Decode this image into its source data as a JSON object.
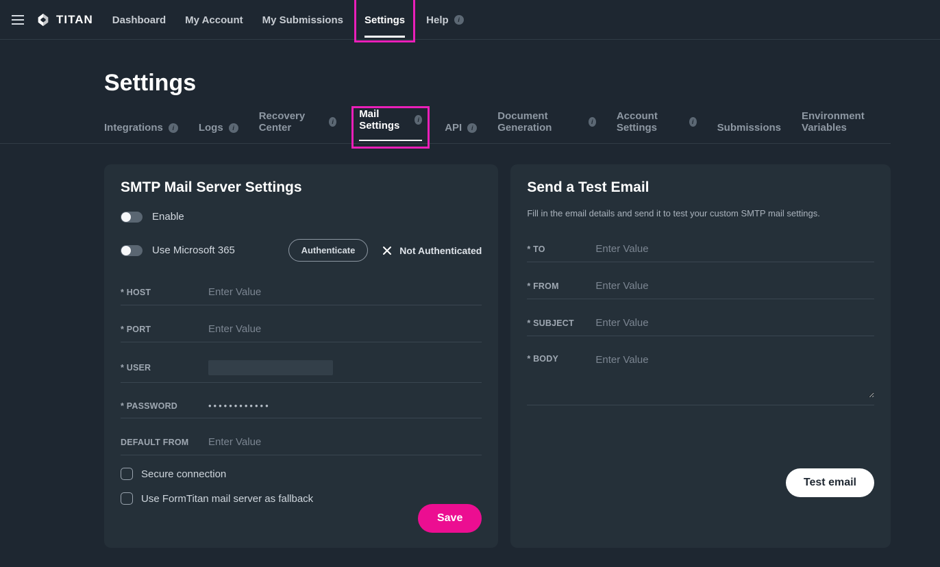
{
  "brand": {
    "name": "TITAN"
  },
  "nav": {
    "dashboard": "Dashboard",
    "my_account": "My Account",
    "my_submissions": "My Submissions",
    "settings": "Settings",
    "help": "Help"
  },
  "page_title": "Settings",
  "subnav": {
    "integrations": "Integrations",
    "logs": "Logs",
    "recovery": "Recovery Center",
    "mail": "Mail Settings",
    "api": "API",
    "docgen": "Document Generation",
    "account": "Account Settings",
    "submissions": "Submissions",
    "env": "Environment Variables"
  },
  "smtp": {
    "title": "SMTP Mail Server Settings",
    "enable_label": "Enable",
    "ms365_label": "Use Microsoft 365",
    "auth_button": "Authenticate",
    "auth_status": "Not Authenticated",
    "fields": {
      "host_label": "* HOST",
      "port_label": "* PORT",
      "user_label": "* USER",
      "password_label": "* PASSWORD",
      "default_from_label": "DEFAULT FROM",
      "placeholder": "Enter Value",
      "password_value": "••••••••••••"
    },
    "secure_label": "Secure connection",
    "fallback_label": "Use FormTitan mail server as fallback",
    "save": "Save"
  },
  "test": {
    "title": "Send a Test Email",
    "desc": "Fill in the email details and send it to test your custom SMTP mail settings.",
    "to_label": "* TO",
    "from_label": "* FROM",
    "subject_label": "* SUBJECT",
    "body_label": "* BODY",
    "placeholder": "Enter Value",
    "button": "Test email"
  },
  "info_badge": "i"
}
